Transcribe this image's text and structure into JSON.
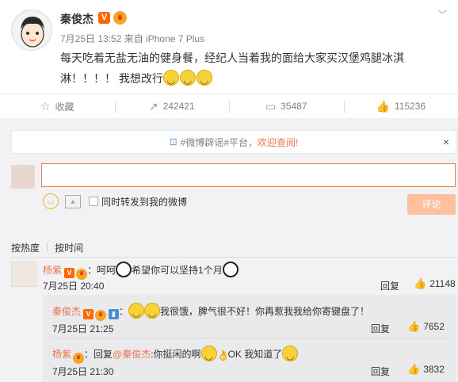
{
  "post": {
    "author": "秦俊杰",
    "verified_badge": "V",
    "meta": "7月25日 13:52 来自 iPhone 7 Plus",
    "content_line1": "每天吃着无盐无油的健身餐，经纪人当着我的面给大家买汉堡鸡腿冰淇",
    "content_line2": "淋！！！！ 我想改行",
    "emoji_count": 3,
    "menu_icon": "chevron-down-icon"
  },
  "actions": [
    {
      "icon": "star-icon",
      "label": "收藏"
    },
    {
      "icon": "share-icon",
      "label": "242421"
    },
    {
      "icon": "comment-icon",
      "label": "35487"
    },
    {
      "icon": "like-icon",
      "label": "115236"
    }
  ],
  "notice": {
    "prefix": "#微博辟谣#平台，",
    "link": "欢迎查阅!",
    "close": "×"
  },
  "composer": {
    "input_value": "",
    "checkbox_label": "同时转发到我的微博",
    "submit_label": "评论"
  },
  "sort": {
    "hot": "按热度",
    "time": "按时间"
  },
  "comments": [
    {
      "name": "杨紫",
      "text_before": "：呵呵",
      "text_after": "希望你可以坚持1个月",
      "time": "7月25日 20:40",
      "reply": "回复",
      "likes": "21148"
    }
  ],
  "replies": [
    {
      "name": "秦俊杰",
      "text": "我很饿，脾气很不好！你再惹我我给你寄键盘了！",
      "time": "7月25日 21:25",
      "reply": "回复",
      "likes": "7652"
    },
    {
      "name": "杨紫",
      "text_before": "：回复",
      "mention": "@秦俊杰",
      "text_mid": ":你挺闲的啊",
      "text_after": "OK 我知道了",
      "time": "7月25日 21:30",
      "reply": "回复",
      "likes": "3832"
    }
  ],
  "colors": {
    "accent": "#eb7350",
    "input_border": "#fa7d3c",
    "submit_disabled": "#ffc09f",
    "comment_bg": "#f2f2f5"
  }
}
